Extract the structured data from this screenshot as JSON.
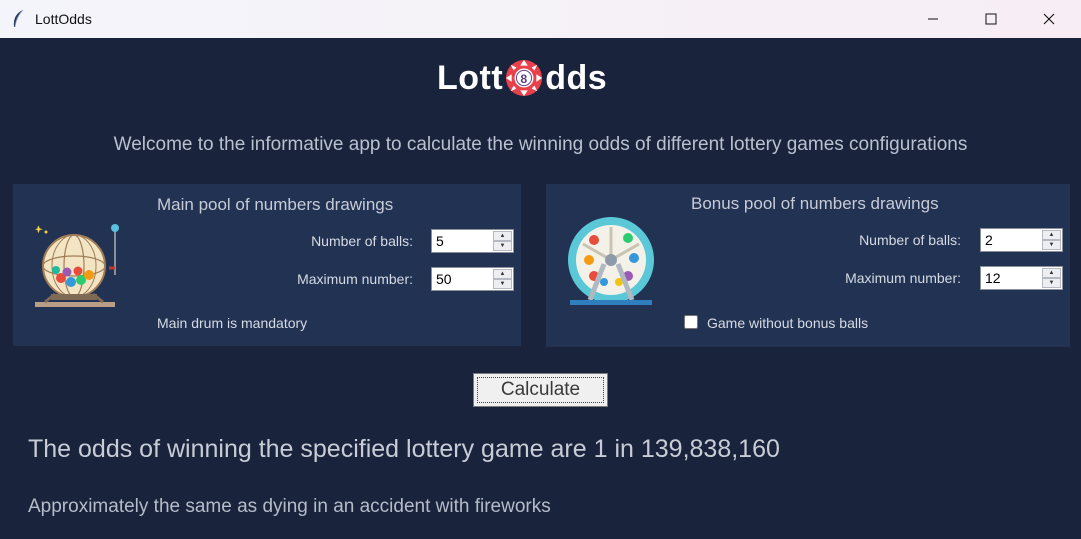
{
  "window": {
    "title": "LottOdds",
    "icon": "feather-icon",
    "controls": [
      "minimize-icon",
      "maximize-icon",
      "close-icon"
    ]
  },
  "logo": {
    "part1": "Lott",
    "ball_number": "8",
    "part2": "dds"
  },
  "welcome": "Welcome to the informative app to calculate the winning odds of different lottery games configurations",
  "main_pool": {
    "title": "Main pool of numbers drawings",
    "balls_label": "Number of balls:",
    "balls_value": "5",
    "max_label": "Maximum number:",
    "max_value": "50",
    "note": "Main drum is mandatory",
    "illustration": "bingo-cage-icon"
  },
  "bonus_pool": {
    "title": "Bonus pool of numbers drawings",
    "balls_label": "Number of balls:",
    "balls_value": "2",
    "max_label": "Maximum number:",
    "max_value": "12",
    "checkbox_label": "Game without bonus balls",
    "checkbox_checked": false,
    "illustration": "lottery-wheel-icon"
  },
  "calculate_label": "Calculate",
  "result": "The odds of winning the specified lottery game are 1 in 139,838,160",
  "comparison": "Approximately the same as dying in an accident with fireworks",
  "colors": {
    "background": "#19233b",
    "panel": "#223253",
    "logo_ball": "#e8414b"
  }
}
